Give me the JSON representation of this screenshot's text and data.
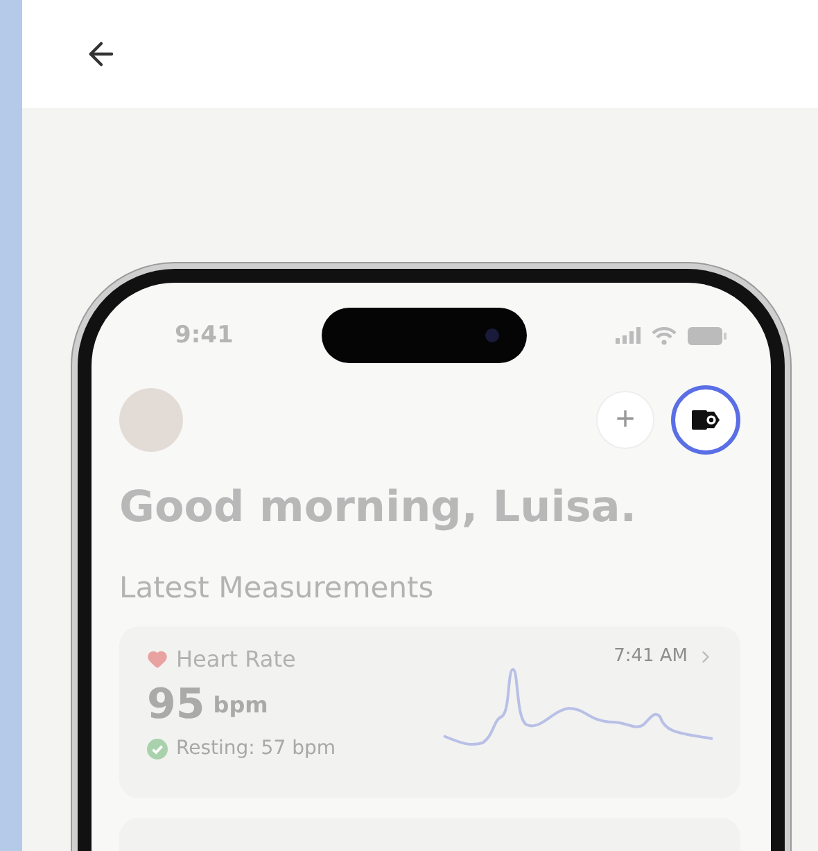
{
  "phone": {
    "status_bar": {
      "time": "9:41"
    },
    "header": {
      "buttons": [
        {
          "kind": "add",
          "label": "+",
          "highlighted": false
        },
        {
          "kind": "watch",
          "highlighted": true
        }
      ]
    },
    "greeting": "Good morning, Luisa.",
    "section_title": "Latest Measurements",
    "cards": [
      {
        "title": "Heart Rate",
        "time": "7:41 AM",
        "value": "95",
        "unit": "bpm",
        "note": "Resting: 57 bpm"
      }
    ]
  }
}
